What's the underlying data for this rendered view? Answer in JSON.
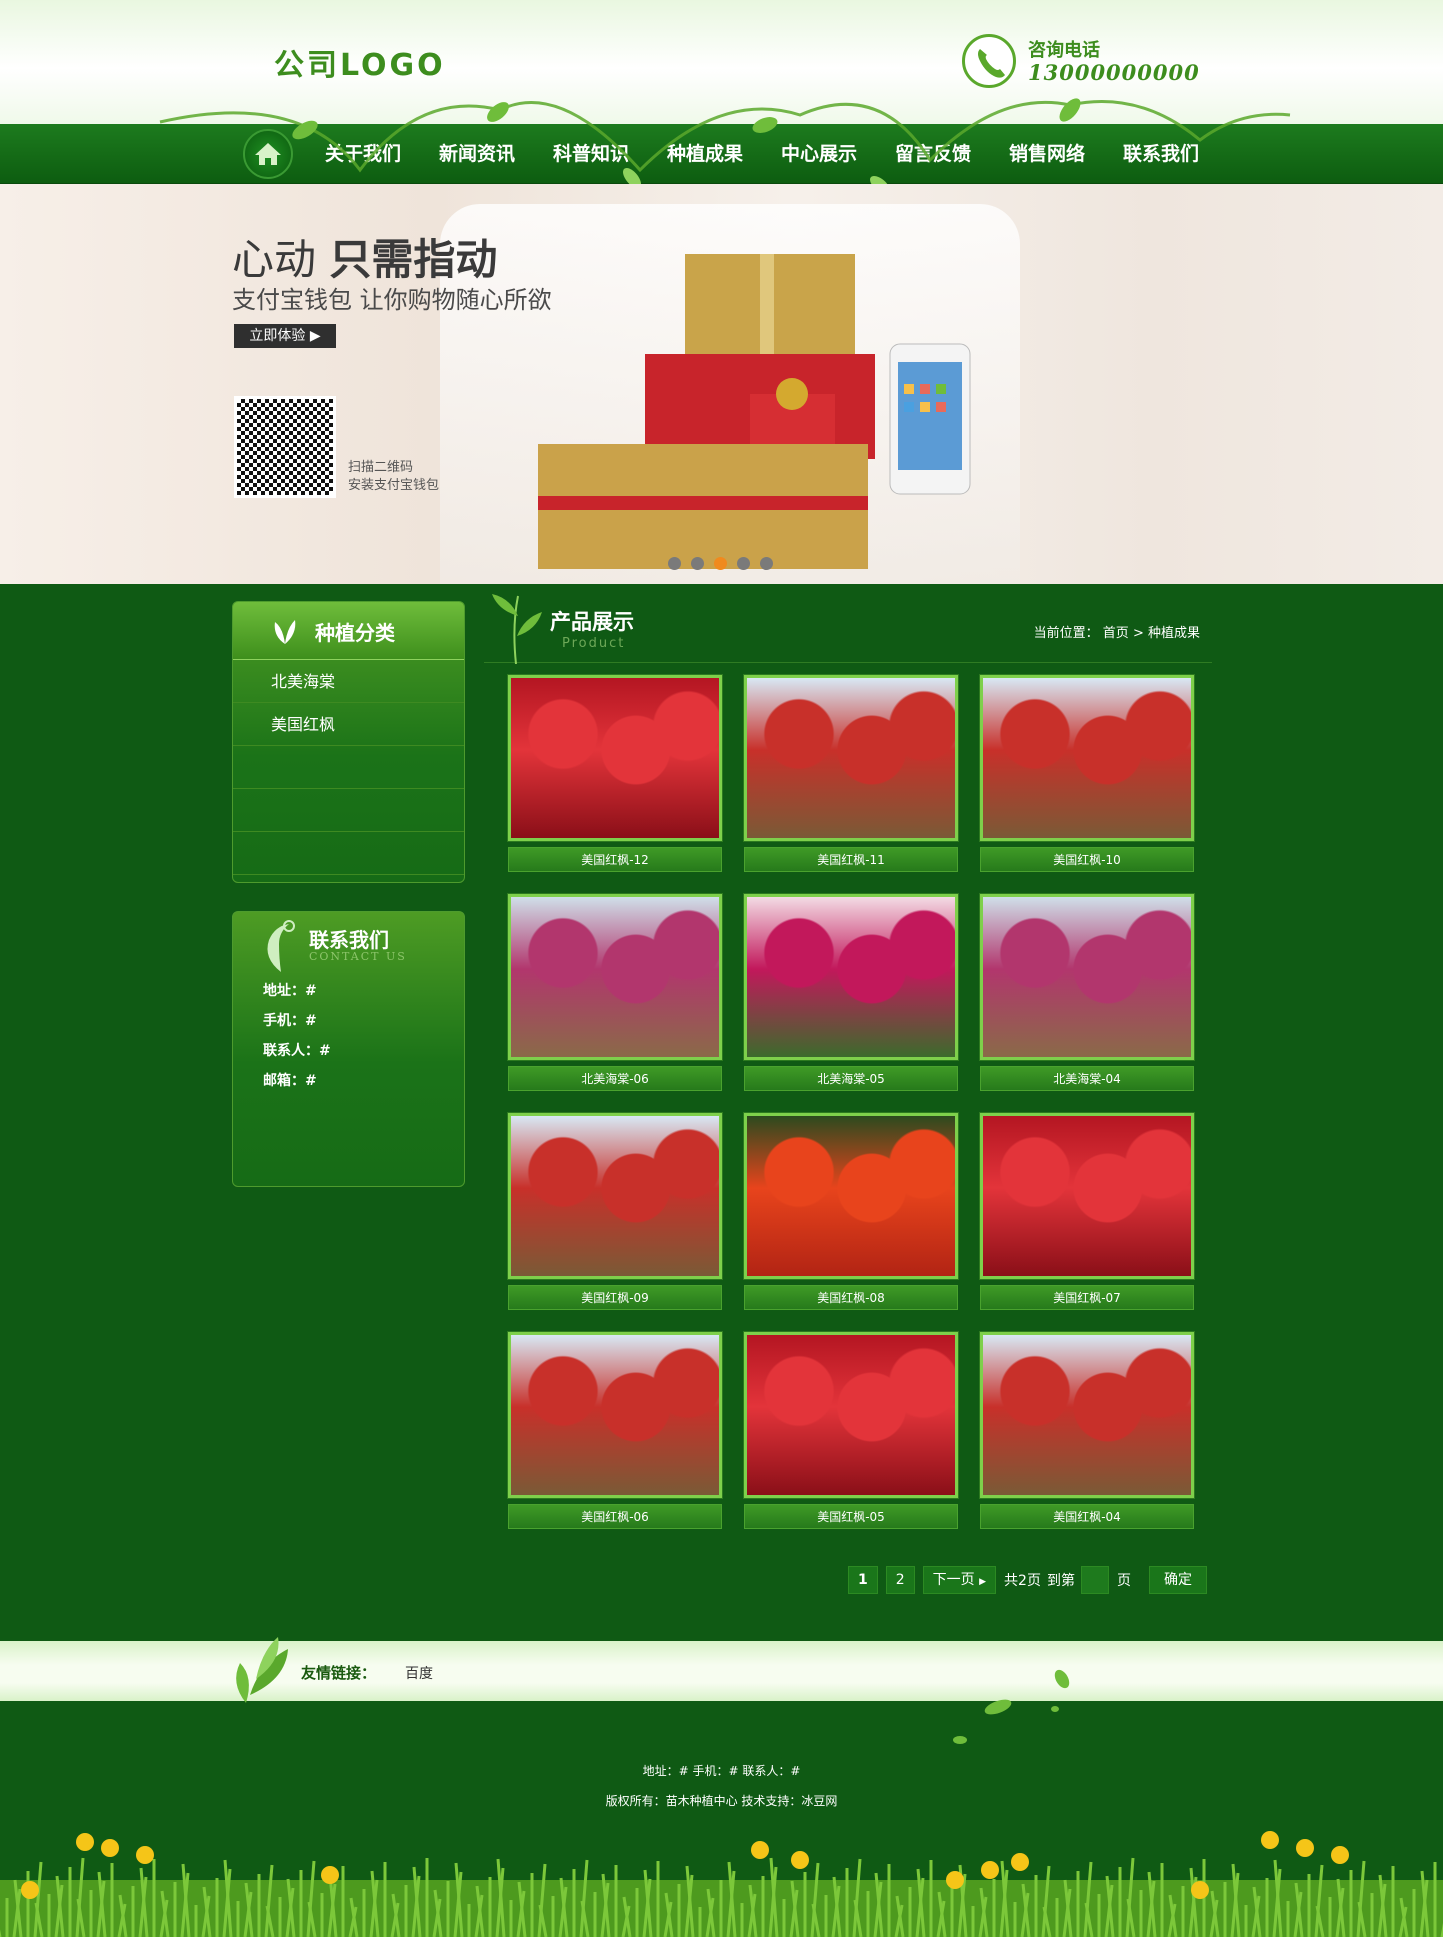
{
  "header": {
    "logo": "公司LOGO",
    "phone_label": "咨询电话",
    "phone_number": "13000000000"
  },
  "nav": {
    "items": [
      "关于我们",
      "新闻资讯",
      "科普知识",
      "种植成果",
      "中心展示",
      "留言反馈",
      "销售网络",
      "联系我们"
    ]
  },
  "banner": {
    "title_light": "心动",
    "title_bold": "只需指动",
    "subtitle": "支付宝钱包  让你购物随心所欲",
    "button": "立即体验",
    "qr_line1": "扫描二维码",
    "qr_line2": "安装支付宝钱包",
    "slides": 5,
    "active_slide": 3
  },
  "sidebar": {
    "category_title": "种植分类",
    "categories": [
      "北美海棠",
      "美国红枫",
      "",
      "",
      ""
    ],
    "contact_title": "联系我们",
    "contact_title_en": "CONTACT US",
    "contact_lines": [
      "地址：#",
      "手机：#",
      "联系人：#",
      "邮箱：#"
    ]
  },
  "main": {
    "title": "产品展示",
    "title_en": "Product",
    "crumb_label": "当前位置：",
    "crumb_home": "首页",
    "crumb_sep": ">",
    "crumb_current": "种植成果"
  },
  "products": [
    {
      "name": "美国红枫-12",
      "tone": "red"
    },
    {
      "name": "美国红枫-11",
      "tone": "redsky"
    },
    {
      "name": "美国红枫-10",
      "tone": "redsky"
    },
    {
      "name": "北美海棠-06",
      "tone": "pink"
    },
    {
      "name": "北美海棠-05",
      "tone": "pinkclose"
    },
    {
      "name": "北美海棠-04",
      "tone": "pink"
    },
    {
      "name": "美国红枫-09",
      "tone": "redsky"
    },
    {
      "name": "美国红枫-08",
      "tone": "redclose"
    },
    {
      "name": "美国红枫-07",
      "tone": "red"
    },
    {
      "name": "美国红枫-06",
      "tone": "redsky"
    },
    {
      "name": "美国红枫-05",
      "tone": "red"
    },
    {
      "name": "美国红枫-04",
      "tone": "redsky"
    }
  ],
  "pagination": {
    "pages": [
      "1",
      "2"
    ],
    "next": "下一页",
    "total": "共2页",
    "goto": "到第",
    "page_unit": "页",
    "confirm": "确定"
  },
  "links": {
    "label": "友情链接：",
    "items": [
      "百度"
    ]
  },
  "footer": {
    "line1": "地址：#    手机：#    联系人：#",
    "line2": "版权所有：苗木种植中心    技术支持：冰豆网"
  },
  "colors": {
    "nav": "#0d5d10",
    "body": "#0f5a14",
    "accent": "#7ed04b",
    "active_dot": "#f08a1e"
  }
}
